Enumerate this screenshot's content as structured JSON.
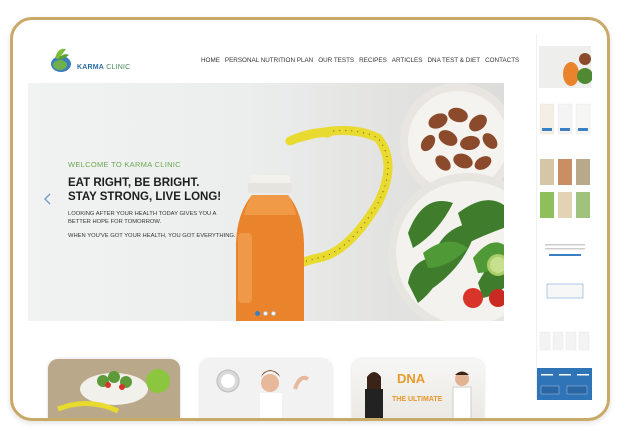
{
  "brand": {
    "logo_text_1": "KARMA",
    "logo_text_2": "CLINIC"
  },
  "nav": {
    "items": [
      {
        "label": "HOME"
      },
      {
        "label": "PERSONAL NUTRITION PLAN"
      },
      {
        "label": "OUR TESTS"
      },
      {
        "label": "RECIPES"
      },
      {
        "label": "ARTICLES"
      },
      {
        "label": "DNA TEST & DIET"
      },
      {
        "label": "CONTACTS"
      }
    ]
  },
  "hero": {
    "welcome": "WELCOME TO KARMA CLINIC",
    "headline_1": "EAT RIGHT, BE BRIGHT.",
    "headline_2": "STAY STRONG, LIVE LONG!",
    "paragraph_1": "Looking after your health today gives you a better hope for tomorrow.",
    "paragraph_2": "When you've got your health, you got everything.",
    "slide_count": 3,
    "active_slide": 1
  },
  "cards": {
    "card3_title": "DNA",
    "card3_subtitle": "THE ULTIMATE"
  },
  "colors": {
    "frame_border": "#c9a968",
    "accent_green": "#6aa84f",
    "accent_blue": "#3b7fc4"
  }
}
